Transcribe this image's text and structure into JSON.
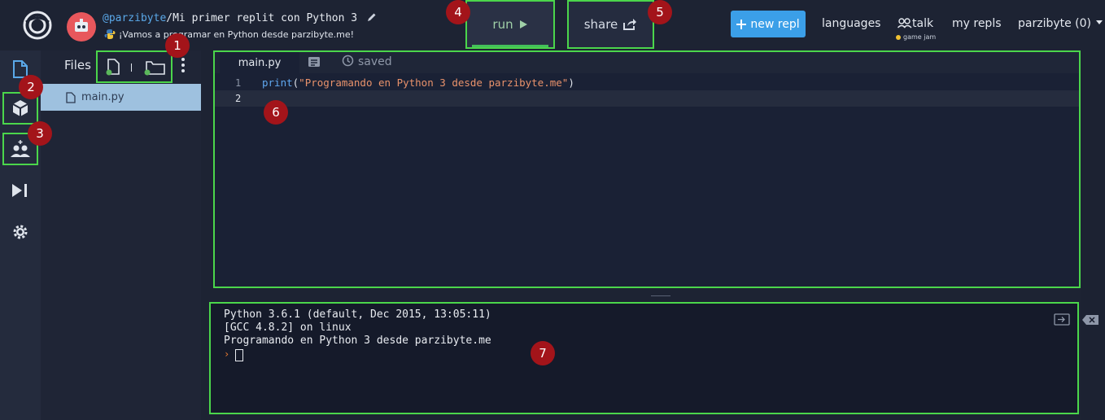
{
  "header": {
    "username": "@parzibyte",
    "repl_name": "/Mi primer replit con Python 3",
    "description": "¡Vamos a programar en Python desde parzibyte.me!",
    "run_label": "run",
    "share_label": "share",
    "new_repl_label": "new repl",
    "nav": [
      "languages",
      "talk",
      "my repls",
      "parzibyte (0)"
    ],
    "talk_sub": "game jam"
  },
  "sidebar": {
    "files_title": "Files"
  },
  "files": [
    {
      "name": "main.py"
    }
  ],
  "editor": {
    "tab": "main.py",
    "saved_label": "saved",
    "line_numbers": [
      "1",
      "2"
    ],
    "code_fn": "print",
    "code_open": "(",
    "code_str": "\"Programando en Python 3 desde parzibyte.me\"",
    "code_close": ")"
  },
  "console": {
    "lines": [
      "Python 3.6.1 (default, Dec 2015, 13:05:11)",
      "[GCC 4.8.2] on linux",
      "Programando en Python 3 desde parzibyte.me"
    ],
    "prompt": "›"
  },
  "badges": [
    "1",
    "2",
    "3",
    "4",
    "5",
    "6",
    "7"
  ],
  "icons": [
    "replit-logo-icon",
    "avatar-icon",
    "pencil-icon",
    "python-icon",
    "play-icon",
    "share-icon",
    "plus-icon",
    "talk-icon",
    "caret-down-icon",
    "file-icon",
    "package-icon",
    "users-icon",
    "debugger-icon",
    "gear-icon",
    "new-file-icon",
    "new-folder-icon",
    "more-icon",
    "markdown-icon",
    "history-icon",
    "exit-icon",
    "clear-icon"
  ],
  "colors": {
    "highlight": "#4bd64b",
    "badge": "#a3141a",
    "accent": "#3b9fe8"
  }
}
